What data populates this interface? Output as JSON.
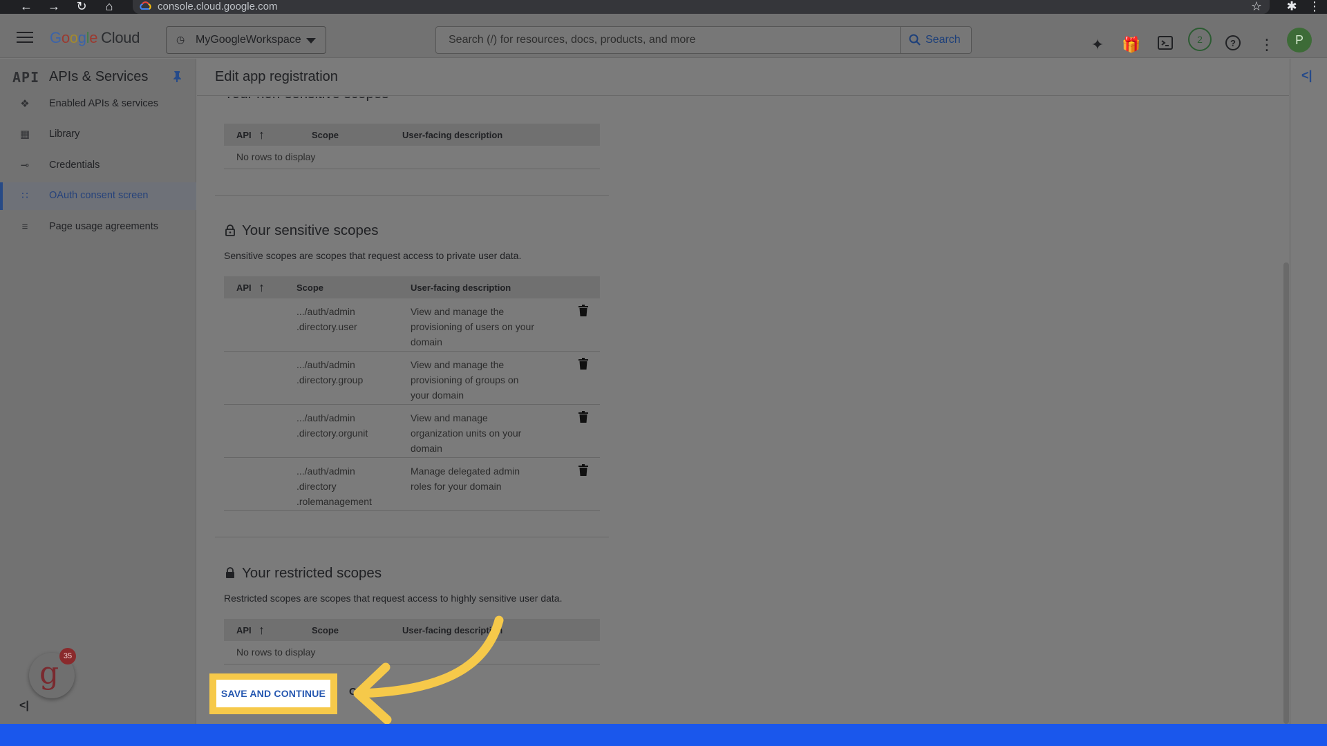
{
  "browser": {
    "url": "console.cloud.google.com"
  },
  "header": {
    "logo_parts": [
      "G",
      "o",
      "o",
      "g",
      "l",
      "e"
    ],
    "logo_suffix": "Cloud",
    "project_name": "MyGoogleWorkspace",
    "search_placeholder": "Search (/) for resources, docs, products, and more",
    "search_button": "Search",
    "notification_count": "2",
    "avatar_initial": "P"
  },
  "sidebar": {
    "badge": "API",
    "title": "APIs & Services",
    "items": [
      {
        "label": "Enabled APIs & services",
        "icon": "diamond-grid-icon",
        "active": false
      },
      {
        "label": "Library",
        "icon": "library-grid-icon",
        "active": false
      },
      {
        "label": "Credentials",
        "icon": "key-icon",
        "active": false
      },
      {
        "label": "OAuth consent screen",
        "icon": "dots-grid-icon",
        "active": true
      },
      {
        "label": "Page usage agreements",
        "icon": "settings-list-icon",
        "active": false
      }
    ],
    "trainer_badge": "35"
  },
  "page": {
    "title": "Edit app registration"
  },
  "non_sensitive": {
    "heading": "Your non-sensitive scopes",
    "columns": [
      "API",
      "Scope",
      "User-facing description"
    ],
    "empty_text": "No rows to display"
  },
  "sensitive": {
    "heading": "Your sensitive scopes",
    "description": "Sensitive scopes are scopes that request access to private user data.",
    "columns": [
      "API",
      "Scope",
      "User-facing description"
    ],
    "rows": [
      {
        "scope": [
          ".../auth/admin",
          ".directory.user"
        ],
        "description": [
          "View and manage the",
          "provisioning of users on your",
          "domain"
        ]
      },
      {
        "scope": [
          ".../auth/admin",
          ".directory.group"
        ],
        "description": [
          "View and manage the",
          "provisioning of groups on",
          "your domain"
        ]
      },
      {
        "scope": [
          ".../auth/admin",
          ".directory.orgunit"
        ],
        "description": [
          "View and manage",
          "organization units on your",
          "domain"
        ]
      },
      {
        "scope": [
          ".../auth/admin",
          ".directory",
          ".rolemanagement"
        ],
        "description": [
          "Manage delegated admin",
          "roles for your domain"
        ]
      }
    ]
  },
  "restricted": {
    "heading": "Your restricted scopes",
    "description": "Restricted scopes are scopes that request access to highly sensitive user data.",
    "columns": [
      "API",
      "Scope",
      "User-facing description"
    ],
    "empty_text": "No rows to display"
  },
  "actions": {
    "save_label": "SAVE AND CONTINUE",
    "cancel_fragment": "C"
  },
  "colors": {
    "highlight": "#f6c94a",
    "arrow": "#f6c94a",
    "bottom_bar": "#1a57ec"
  }
}
